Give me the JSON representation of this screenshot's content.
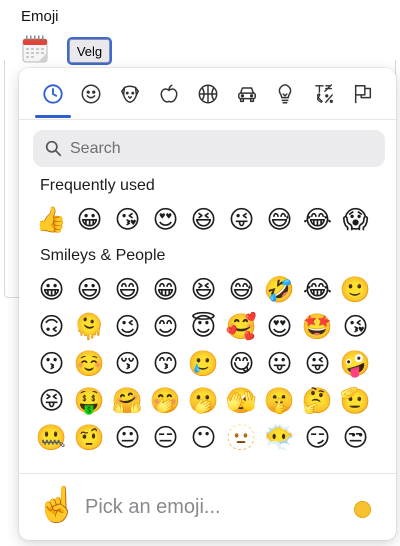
{
  "field": {
    "label": "Emoji",
    "button_label": "Velg"
  },
  "picker": {
    "tabs": [
      {
        "id": "recent",
        "icon": "clock-icon"
      },
      {
        "id": "smileys",
        "icon": "smiley-icon"
      },
      {
        "id": "animals",
        "icon": "dog-icon"
      },
      {
        "id": "food",
        "icon": "apple-icon"
      },
      {
        "id": "activities",
        "icon": "basketball-icon"
      },
      {
        "id": "travel",
        "icon": "car-icon"
      },
      {
        "id": "objects",
        "icon": "lightbulb-icon"
      },
      {
        "id": "symbols",
        "icon": "symbols-icon"
      },
      {
        "id": "flags",
        "icon": "flag-icon"
      }
    ],
    "active_tab": "recent",
    "search": {
      "placeholder": "Search",
      "value": ""
    },
    "sections": [
      {
        "title": "Frequently used",
        "emojis": [
          "👍",
          "😀",
          "😘",
          "😍",
          "😆",
          "😜",
          "😅",
          "😂",
          "😱"
        ]
      },
      {
        "title": "Smileys & People",
        "emojis": [
          "😀",
          "😃",
          "😄",
          "😁",
          "😆",
          "😅",
          "🤣",
          "😂",
          "🙂",
          "🙃",
          "🫠",
          "😉",
          "😊",
          "😇",
          "🥰",
          "😍",
          "🤩",
          "😘",
          "😗",
          "☺️",
          "😚",
          "😙",
          "🥲",
          "😋",
          "😛",
          "😜",
          "🤪",
          "😝",
          "🤑",
          "🤗",
          "🤭",
          "🫢",
          "🫣",
          "🤫",
          "🤔",
          "🫡",
          "🤐",
          "🤨",
          "😐",
          "😑",
          "😶",
          "🫥",
          "😶‍🌫️",
          "😏",
          "😒"
        ]
      }
    ],
    "footer": {
      "preview_emoji": "☝️",
      "prompt": "Pick an emoji...",
      "skin_tone_color": "#f7c230"
    }
  },
  "colors": {
    "accent": "#2d5fd3",
    "button_border": "#3b69d6"
  }
}
